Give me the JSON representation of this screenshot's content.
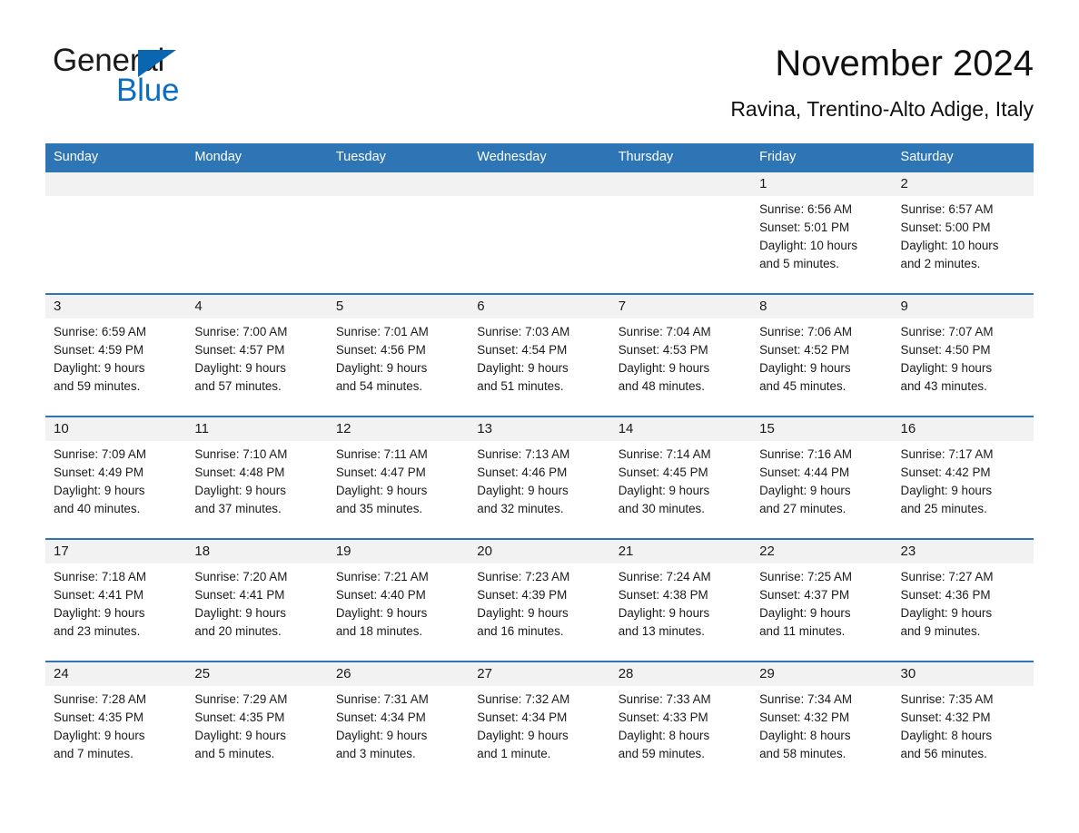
{
  "brand": {
    "name_top": "General",
    "name_bottom": "Blue",
    "triangle_color": "#0a66b0",
    "blue_color": "#0a6dc2"
  },
  "header": {
    "title": "November 2024",
    "location": "Ravina, Trentino-Alto Adige, Italy"
  },
  "theme": {
    "header_blue": "#2e75b6",
    "day_band_gray": "#f2f2f2",
    "text_color": "#1a1a1a"
  },
  "weekdays": [
    "Sunday",
    "Monday",
    "Tuesday",
    "Wednesday",
    "Thursday",
    "Friday",
    "Saturday"
  ],
  "weeks": [
    [
      {
        "date": "",
        "sunrise": "",
        "sunset": "",
        "daylight_line1": "",
        "daylight_line2": ""
      },
      {
        "date": "",
        "sunrise": "",
        "sunset": "",
        "daylight_line1": "",
        "daylight_line2": ""
      },
      {
        "date": "",
        "sunrise": "",
        "sunset": "",
        "daylight_line1": "",
        "daylight_line2": ""
      },
      {
        "date": "",
        "sunrise": "",
        "sunset": "",
        "daylight_line1": "",
        "daylight_line2": ""
      },
      {
        "date": "",
        "sunrise": "",
        "sunset": "",
        "daylight_line1": "",
        "daylight_line2": ""
      },
      {
        "date": "1",
        "sunrise": "Sunrise: 6:56 AM",
        "sunset": "Sunset: 5:01 PM",
        "daylight_line1": "Daylight: 10 hours",
        "daylight_line2": "and 5 minutes."
      },
      {
        "date": "2",
        "sunrise": "Sunrise: 6:57 AM",
        "sunset": "Sunset: 5:00 PM",
        "daylight_line1": "Daylight: 10 hours",
        "daylight_line2": "and 2 minutes."
      }
    ],
    [
      {
        "date": "3",
        "sunrise": "Sunrise: 6:59 AM",
        "sunset": "Sunset: 4:59 PM",
        "daylight_line1": "Daylight: 9 hours",
        "daylight_line2": "and 59 minutes."
      },
      {
        "date": "4",
        "sunrise": "Sunrise: 7:00 AM",
        "sunset": "Sunset: 4:57 PM",
        "daylight_line1": "Daylight: 9 hours",
        "daylight_line2": "and 57 minutes."
      },
      {
        "date": "5",
        "sunrise": "Sunrise: 7:01 AM",
        "sunset": "Sunset: 4:56 PM",
        "daylight_line1": "Daylight: 9 hours",
        "daylight_line2": "and 54 minutes."
      },
      {
        "date": "6",
        "sunrise": "Sunrise: 7:03 AM",
        "sunset": "Sunset: 4:54 PM",
        "daylight_line1": "Daylight: 9 hours",
        "daylight_line2": "and 51 minutes."
      },
      {
        "date": "7",
        "sunrise": "Sunrise: 7:04 AM",
        "sunset": "Sunset: 4:53 PM",
        "daylight_line1": "Daylight: 9 hours",
        "daylight_line2": "and 48 minutes."
      },
      {
        "date": "8",
        "sunrise": "Sunrise: 7:06 AM",
        "sunset": "Sunset: 4:52 PM",
        "daylight_line1": "Daylight: 9 hours",
        "daylight_line2": "and 45 minutes."
      },
      {
        "date": "9",
        "sunrise": "Sunrise: 7:07 AM",
        "sunset": "Sunset: 4:50 PM",
        "daylight_line1": "Daylight: 9 hours",
        "daylight_line2": "and 43 minutes."
      }
    ],
    [
      {
        "date": "10",
        "sunrise": "Sunrise: 7:09 AM",
        "sunset": "Sunset: 4:49 PM",
        "daylight_line1": "Daylight: 9 hours",
        "daylight_line2": "and 40 minutes."
      },
      {
        "date": "11",
        "sunrise": "Sunrise: 7:10 AM",
        "sunset": "Sunset: 4:48 PM",
        "daylight_line1": "Daylight: 9 hours",
        "daylight_line2": "and 37 minutes."
      },
      {
        "date": "12",
        "sunrise": "Sunrise: 7:11 AM",
        "sunset": "Sunset: 4:47 PM",
        "daylight_line1": "Daylight: 9 hours",
        "daylight_line2": "and 35 minutes."
      },
      {
        "date": "13",
        "sunrise": "Sunrise: 7:13 AM",
        "sunset": "Sunset: 4:46 PM",
        "daylight_line1": "Daylight: 9 hours",
        "daylight_line2": "and 32 minutes."
      },
      {
        "date": "14",
        "sunrise": "Sunrise: 7:14 AM",
        "sunset": "Sunset: 4:45 PM",
        "daylight_line1": "Daylight: 9 hours",
        "daylight_line2": "and 30 minutes."
      },
      {
        "date": "15",
        "sunrise": "Sunrise: 7:16 AM",
        "sunset": "Sunset: 4:44 PM",
        "daylight_line1": "Daylight: 9 hours",
        "daylight_line2": "and 27 minutes."
      },
      {
        "date": "16",
        "sunrise": "Sunrise: 7:17 AM",
        "sunset": "Sunset: 4:42 PM",
        "daylight_line1": "Daylight: 9 hours",
        "daylight_line2": "and 25 minutes."
      }
    ],
    [
      {
        "date": "17",
        "sunrise": "Sunrise: 7:18 AM",
        "sunset": "Sunset: 4:41 PM",
        "daylight_line1": "Daylight: 9 hours",
        "daylight_line2": "and 23 minutes."
      },
      {
        "date": "18",
        "sunrise": "Sunrise: 7:20 AM",
        "sunset": "Sunset: 4:41 PM",
        "daylight_line1": "Daylight: 9 hours",
        "daylight_line2": "and 20 minutes."
      },
      {
        "date": "19",
        "sunrise": "Sunrise: 7:21 AM",
        "sunset": "Sunset: 4:40 PM",
        "daylight_line1": "Daylight: 9 hours",
        "daylight_line2": "and 18 minutes."
      },
      {
        "date": "20",
        "sunrise": "Sunrise: 7:23 AM",
        "sunset": "Sunset: 4:39 PM",
        "daylight_line1": "Daylight: 9 hours",
        "daylight_line2": "and 16 minutes."
      },
      {
        "date": "21",
        "sunrise": "Sunrise: 7:24 AM",
        "sunset": "Sunset: 4:38 PM",
        "daylight_line1": "Daylight: 9 hours",
        "daylight_line2": "and 13 minutes."
      },
      {
        "date": "22",
        "sunrise": "Sunrise: 7:25 AM",
        "sunset": "Sunset: 4:37 PM",
        "daylight_line1": "Daylight: 9 hours",
        "daylight_line2": "and 11 minutes."
      },
      {
        "date": "23",
        "sunrise": "Sunrise: 7:27 AM",
        "sunset": "Sunset: 4:36 PM",
        "daylight_line1": "Daylight: 9 hours",
        "daylight_line2": "and 9 minutes."
      }
    ],
    [
      {
        "date": "24",
        "sunrise": "Sunrise: 7:28 AM",
        "sunset": "Sunset: 4:35 PM",
        "daylight_line1": "Daylight: 9 hours",
        "daylight_line2": "and 7 minutes."
      },
      {
        "date": "25",
        "sunrise": "Sunrise: 7:29 AM",
        "sunset": "Sunset: 4:35 PM",
        "daylight_line1": "Daylight: 9 hours",
        "daylight_line2": "and 5 minutes."
      },
      {
        "date": "26",
        "sunrise": "Sunrise: 7:31 AM",
        "sunset": "Sunset: 4:34 PM",
        "daylight_line1": "Daylight: 9 hours",
        "daylight_line2": "and 3 minutes."
      },
      {
        "date": "27",
        "sunrise": "Sunrise: 7:32 AM",
        "sunset": "Sunset: 4:34 PM",
        "daylight_line1": "Daylight: 9 hours",
        "daylight_line2": "and 1 minute."
      },
      {
        "date": "28",
        "sunrise": "Sunrise: 7:33 AM",
        "sunset": "Sunset: 4:33 PM",
        "daylight_line1": "Daylight: 8 hours",
        "daylight_line2": "and 59 minutes."
      },
      {
        "date": "29",
        "sunrise": "Sunrise: 7:34 AM",
        "sunset": "Sunset: 4:32 PM",
        "daylight_line1": "Daylight: 8 hours",
        "daylight_line2": "and 58 minutes."
      },
      {
        "date": "30",
        "sunrise": "Sunrise: 7:35 AM",
        "sunset": "Sunset: 4:32 PM",
        "daylight_line1": "Daylight: 8 hours",
        "daylight_line2": "and 56 minutes."
      }
    ]
  ]
}
